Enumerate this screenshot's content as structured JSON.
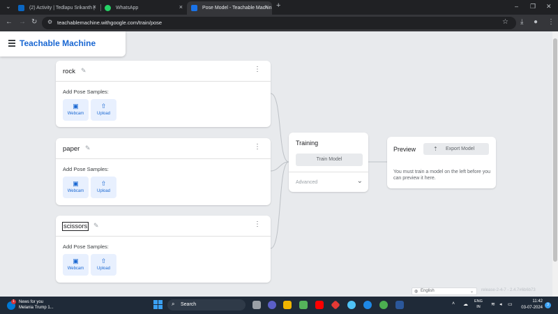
{
  "browser": {
    "tabs": [
      {
        "label": "(2) Activity | Tedlapu Srikanth |",
        "favicon_color": "#0a66c2",
        "favicon_text": "in"
      },
      {
        "label": "WhatsApp",
        "favicon_color": "#25d366",
        "favicon_text": ""
      },
      {
        "label": "Pose Model - Teachable Machin",
        "favicon_color": "#1a73e8",
        "favicon_text": "TM"
      }
    ],
    "new_tab": "+",
    "close_glyph": "×",
    "url": "teachablemachine.withgoogle.com/train/pose"
  },
  "app": {
    "title": "Teachable Machine",
    "classes": [
      {
        "name": "rock",
        "add_label": "Add Pose Samples:",
        "webcam_label": "Webcam",
        "upload_label": "Upload"
      },
      {
        "name": "paper",
        "add_label": "Add Pose Samples:",
        "webcam_label": "Webcam",
        "upload_label": "Upload"
      },
      {
        "name": "scissors",
        "add_label": "Add Pose Samples:",
        "webcam_label": "Webcam",
        "upload_label": "Upload"
      }
    ],
    "training": {
      "title": "Training",
      "train_button": "Train Model",
      "advanced_label": "Advanced"
    },
    "preview": {
      "title": "Preview",
      "export_button": "Export Model",
      "message": "You must train a model on the left before you can preview it here."
    },
    "language": "English",
    "version": "release-2-4-7 - 2.4.7#6b6b73"
  },
  "taskbar": {
    "news_title": "News for you",
    "news_subtitle": "Melania Trump 1...",
    "news_badge": "1",
    "search_label": "Search",
    "lang_line1": "ENG",
    "lang_line2": "IN",
    "time": "11:42",
    "date": "03-07-2024",
    "notif_badge": "3"
  },
  "colors": {
    "brand": "#1967d2",
    "accent_bg": "#e8f0fe"
  }
}
